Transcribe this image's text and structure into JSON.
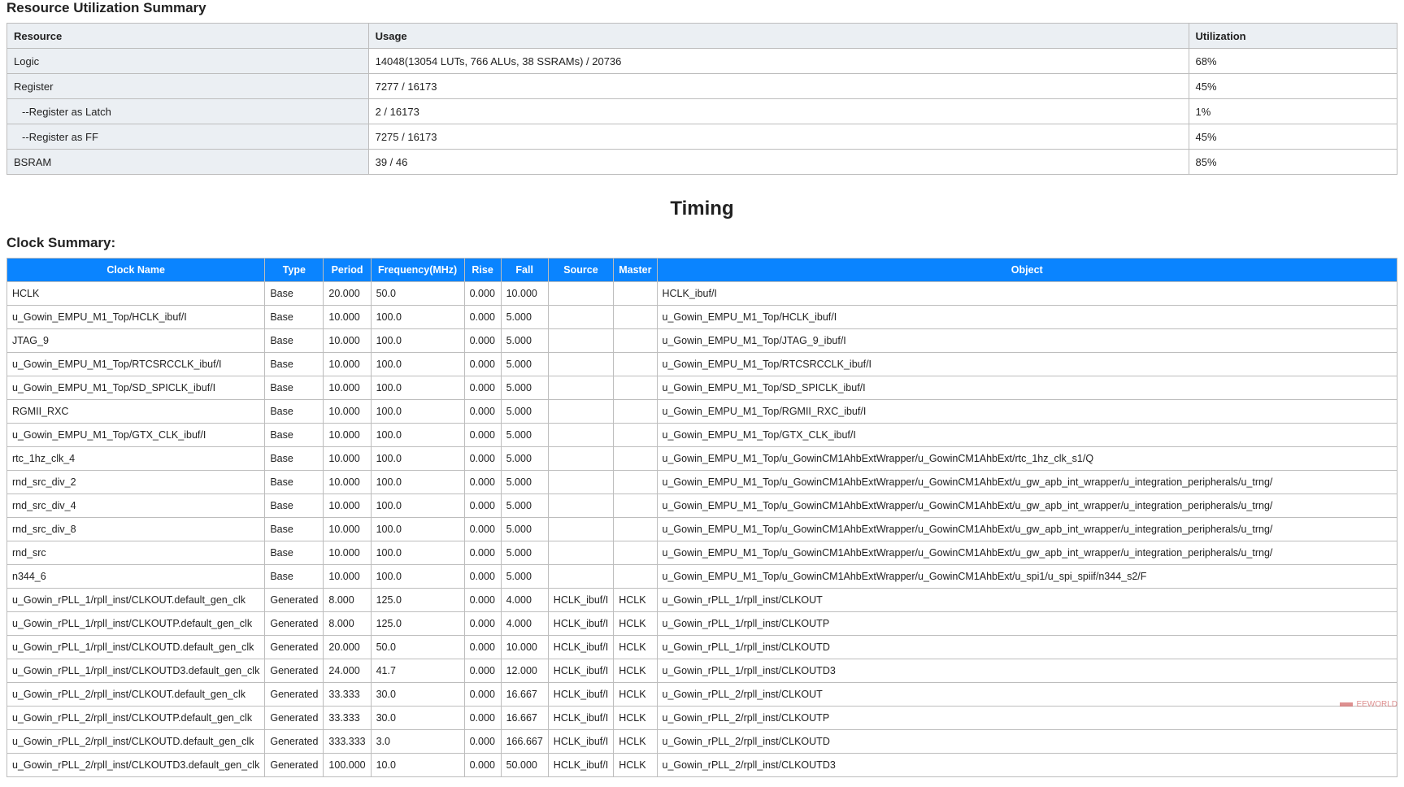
{
  "resource_section": {
    "title": "Resource Utilization Summary",
    "headers": [
      "Resource",
      "Usage",
      "Utilization"
    ],
    "rows": [
      {
        "resource": "Logic",
        "usage": "14048(13054 LUTs, 766 ALUs, 38 SSRAMs) / 20736",
        "utilization": "68%",
        "indent": false
      },
      {
        "resource": "Register",
        "usage": "7277 / 16173",
        "utilization": "45%",
        "indent": false
      },
      {
        "resource": "--Register as Latch",
        "usage": "2 / 16173",
        "utilization": "1%",
        "indent": true
      },
      {
        "resource": "--Register as FF",
        "usage": "7275 / 16173",
        "utilization": "45%",
        "indent": true
      },
      {
        "resource": "BSRAM",
        "usage": "39 / 46",
        "utilization": "85%",
        "indent": false
      }
    ]
  },
  "timing_title": "Timing",
  "clock_section": {
    "title": "Clock Summary:",
    "headers": [
      "Clock Name",
      "Type",
      "Period",
      "Frequency(MHz)",
      "Rise",
      "Fall",
      "Source",
      "Master",
      "Object"
    ],
    "rows": [
      {
        "name": "HCLK",
        "type": "Base",
        "period": "20.000",
        "freq": "50.0",
        "rise": "0.000",
        "fall": "10.000",
        "source": "",
        "master": "",
        "object": "HCLK_ibuf/I"
      },
      {
        "name": "u_Gowin_EMPU_M1_Top/HCLK_ibuf/I",
        "type": "Base",
        "period": "10.000",
        "freq": "100.0",
        "rise": "0.000",
        "fall": "5.000",
        "source": "",
        "master": "",
        "object": "u_Gowin_EMPU_M1_Top/HCLK_ibuf/I"
      },
      {
        "name": "JTAG_9",
        "type": "Base",
        "period": "10.000",
        "freq": "100.0",
        "rise": "0.000",
        "fall": "5.000",
        "source": "",
        "master": "",
        "object": "u_Gowin_EMPU_M1_Top/JTAG_9_ibuf/I"
      },
      {
        "name": "u_Gowin_EMPU_M1_Top/RTCSRCCLK_ibuf/I",
        "type": "Base",
        "period": "10.000",
        "freq": "100.0",
        "rise": "0.000",
        "fall": "5.000",
        "source": "",
        "master": "",
        "object": "u_Gowin_EMPU_M1_Top/RTCSRCCLK_ibuf/I"
      },
      {
        "name": "u_Gowin_EMPU_M1_Top/SD_SPICLK_ibuf/I",
        "type": "Base",
        "period": "10.000",
        "freq": "100.0",
        "rise": "0.000",
        "fall": "5.000",
        "source": "",
        "master": "",
        "object": "u_Gowin_EMPU_M1_Top/SD_SPICLK_ibuf/I"
      },
      {
        "name": "RGMII_RXC",
        "type": "Base",
        "period": "10.000",
        "freq": "100.0",
        "rise": "0.000",
        "fall": "5.000",
        "source": "",
        "master": "",
        "object": "u_Gowin_EMPU_M1_Top/RGMII_RXC_ibuf/I"
      },
      {
        "name": "u_Gowin_EMPU_M1_Top/GTX_CLK_ibuf/I",
        "type": "Base",
        "period": "10.000",
        "freq": "100.0",
        "rise": "0.000",
        "fall": "5.000",
        "source": "",
        "master": "",
        "object": "u_Gowin_EMPU_M1_Top/GTX_CLK_ibuf/I"
      },
      {
        "name": "rtc_1hz_clk_4",
        "type": "Base",
        "period": "10.000",
        "freq": "100.0",
        "rise": "0.000",
        "fall": "5.000",
        "source": "",
        "master": "",
        "object": "u_Gowin_EMPU_M1_Top/u_GowinCM1AhbExtWrapper/u_GowinCM1AhbExt/rtc_1hz_clk_s1/Q"
      },
      {
        "name": "rnd_src_div_2",
        "type": "Base",
        "period": "10.000",
        "freq": "100.0",
        "rise": "0.000",
        "fall": "5.000",
        "source": "",
        "master": "",
        "object": "u_Gowin_EMPU_M1_Top/u_GowinCM1AhbExtWrapper/u_GowinCM1AhbExt/u_gw_apb_int_wrapper/u_integration_peripherals/u_trng/"
      },
      {
        "name": "rnd_src_div_4",
        "type": "Base",
        "period": "10.000",
        "freq": "100.0",
        "rise": "0.000",
        "fall": "5.000",
        "source": "",
        "master": "",
        "object": "u_Gowin_EMPU_M1_Top/u_GowinCM1AhbExtWrapper/u_GowinCM1AhbExt/u_gw_apb_int_wrapper/u_integration_peripherals/u_trng/"
      },
      {
        "name": "rnd_src_div_8",
        "type": "Base",
        "period": "10.000",
        "freq": "100.0",
        "rise": "0.000",
        "fall": "5.000",
        "source": "",
        "master": "",
        "object": "u_Gowin_EMPU_M1_Top/u_GowinCM1AhbExtWrapper/u_GowinCM1AhbExt/u_gw_apb_int_wrapper/u_integration_peripherals/u_trng/"
      },
      {
        "name": "rnd_src",
        "type": "Base",
        "period": "10.000",
        "freq": "100.0",
        "rise": "0.000",
        "fall": "5.000",
        "source": "",
        "master": "",
        "object": "u_Gowin_EMPU_M1_Top/u_GowinCM1AhbExtWrapper/u_GowinCM1AhbExt/u_gw_apb_int_wrapper/u_integration_peripherals/u_trng/"
      },
      {
        "name": "n344_6",
        "type": "Base",
        "period": "10.000",
        "freq": "100.0",
        "rise": "0.000",
        "fall": "5.000",
        "source": "",
        "master": "",
        "object": "u_Gowin_EMPU_M1_Top/u_GowinCM1AhbExtWrapper/u_GowinCM1AhbExt/u_spi1/u_spi_spiif/n344_s2/F"
      },
      {
        "name": "u_Gowin_rPLL_1/rpll_inst/CLKOUT.default_gen_clk",
        "type": "Generated",
        "period": "8.000",
        "freq": "125.0",
        "rise": "0.000",
        "fall": "4.000",
        "source": "HCLK_ibuf/I",
        "master": "HCLK",
        "object": "u_Gowin_rPLL_1/rpll_inst/CLKOUT"
      },
      {
        "name": "u_Gowin_rPLL_1/rpll_inst/CLKOUTP.default_gen_clk",
        "type": "Generated",
        "period": "8.000",
        "freq": "125.0",
        "rise": "0.000",
        "fall": "4.000",
        "source": "HCLK_ibuf/I",
        "master": "HCLK",
        "object": "u_Gowin_rPLL_1/rpll_inst/CLKOUTP"
      },
      {
        "name": "u_Gowin_rPLL_1/rpll_inst/CLKOUTD.default_gen_clk",
        "type": "Generated",
        "period": "20.000",
        "freq": "50.0",
        "rise": "0.000",
        "fall": "10.000",
        "source": "HCLK_ibuf/I",
        "master": "HCLK",
        "object": "u_Gowin_rPLL_1/rpll_inst/CLKOUTD"
      },
      {
        "name": "u_Gowin_rPLL_1/rpll_inst/CLKOUTD3.default_gen_clk",
        "type": "Generated",
        "period": "24.000",
        "freq": "41.7",
        "rise": "0.000",
        "fall": "12.000",
        "source": "HCLK_ibuf/I",
        "master": "HCLK",
        "object": "u_Gowin_rPLL_1/rpll_inst/CLKOUTD3"
      },
      {
        "name": "u_Gowin_rPLL_2/rpll_inst/CLKOUT.default_gen_clk",
        "type": "Generated",
        "period": "33.333",
        "freq": "30.0",
        "rise": "0.000",
        "fall": "16.667",
        "source": "HCLK_ibuf/I",
        "master": "HCLK",
        "object": "u_Gowin_rPLL_2/rpll_inst/CLKOUT"
      },
      {
        "name": "u_Gowin_rPLL_2/rpll_inst/CLKOUTP.default_gen_clk",
        "type": "Generated",
        "period": "33.333",
        "freq": "30.0",
        "rise": "0.000",
        "fall": "16.667",
        "source": "HCLK_ibuf/I",
        "master": "HCLK",
        "object": "u_Gowin_rPLL_2/rpll_inst/CLKOUTP"
      },
      {
        "name": "u_Gowin_rPLL_2/rpll_inst/CLKOUTD.default_gen_clk",
        "type": "Generated",
        "period": "333.333",
        "freq": "3.0",
        "rise": "0.000",
        "fall": "166.667",
        "source": "HCLK_ibuf/I",
        "master": "HCLK",
        "object": "u_Gowin_rPLL_2/rpll_inst/CLKOUTD"
      },
      {
        "name": "u_Gowin_rPLL_2/rpll_inst/CLKOUTD3.default_gen_clk",
        "type": "Generated",
        "period": "100.000",
        "freq": "10.0",
        "rise": "0.000",
        "fall": "50.000",
        "source": "HCLK_ibuf/I",
        "master": "HCLK",
        "object": "u_Gowin_rPLL_2/rpll_inst/CLKOUTD3"
      }
    ]
  },
  "watermark": "EEWORLD"
}
